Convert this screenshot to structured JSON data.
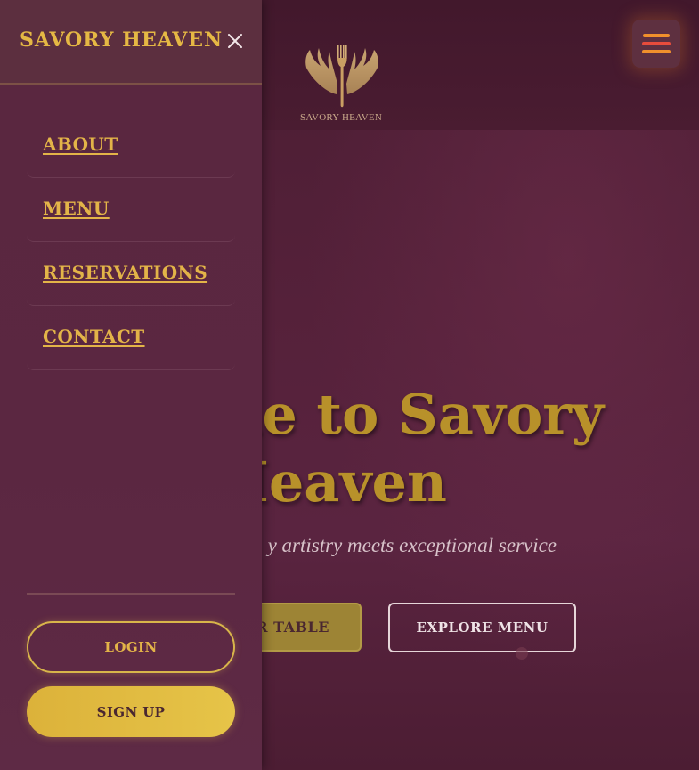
{
  "colors": {
    "accent_gold": "#e3b448",
    "background": "#55213a",
    "drawer": "#5a2740",
    "hamburger_orange": "#f0902c",
    "hamburger_red": "#e74c3c"
  },
  "header": {
    "logo_icon": "fork-wings-logo-icon",
    "logo_text": "SAVORY HEAVEN",
    "menu_icon": "hamburger-menu-icon"
  },
  "hero": {
    "title_line1": "me to Savory",
    "title_line2": "Heaven",
    "subtitle": "y artistry meets exceptional service",
    "book_button": "R TABLE",
    "explore_button": "EXPLORE MENU"
  },
  "drawer": {
    "brand": "SAVORY HEAVEN",
    "close_icon": "close-icon",
    "nav": [
      {
        "label": "ABOUT"
      },
      {
        "label": "MENU"
      },
      {
        "label": "RESERVATIONS"
      },
      {
        "label": "CONTACT"
      }
    ],
    "login_label": "LOGIN",
    "signup_label": "SIGN UP"
  }
}
